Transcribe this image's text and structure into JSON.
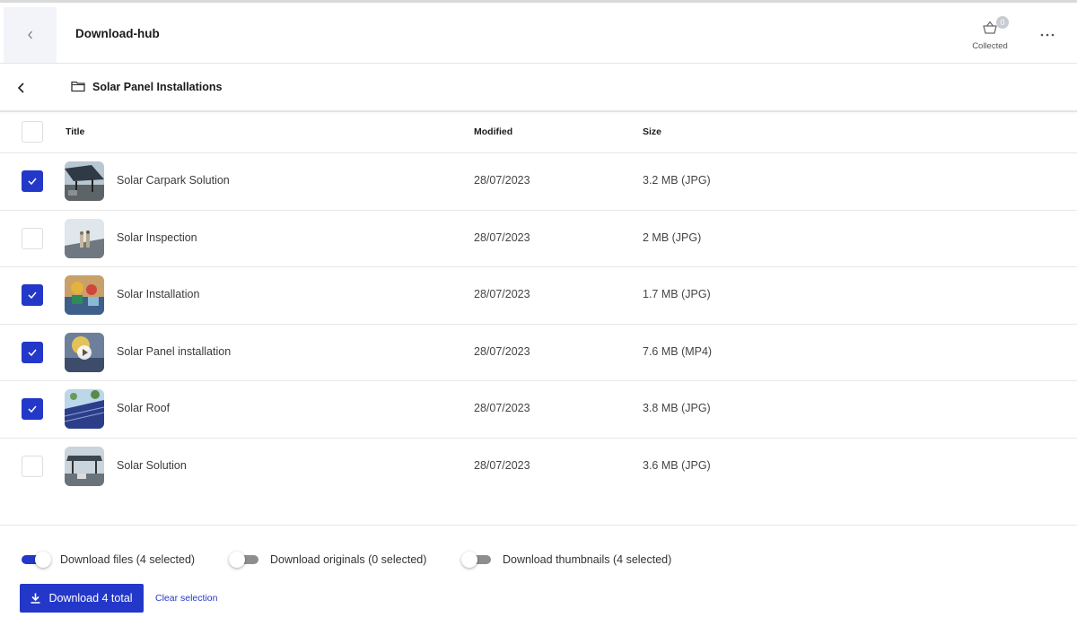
{
  "header": {
    "app_title": "Download-hub",
    "collected_label": "Collected",
    "collected_count": "0",
    "back_icon": "chevron-left-icon",
    "basket_icon": "basket-icon",
    "more_icon": "more-horizontal-icon"
  },
  "folder": {
    "name": "Solar Panel Installations",
    "icon": "folder-icon"
  },
  "table": {
    "columns": [
      "Title",
      "Modified",
      "Size"
    ],
    "rows": [
      {
        "title": "Solar Carpark Solution",
        "modified": "28/07/2023",
        "size": "3.2 MB (JPG)",
        "checked": true
      },
      {
        "title": "Solar Inspection",
        "modified": "28/07/2023",
        "size": "2 MB (JPG)",
        "checked": false
      },
      {
        "title": "Solar Installation",
        "modified": "28/07/2023",
        "size": "1.7 MB (JPG)",
        "checked": true
      },
      {
        "title": "Solar Panel installation",
        "modified": "28/07/2023",
        "size": "7.6 MB (MP4)",
        "checked": true
      },
      {
        "title": "Solar Roof",
        "modified": "28/07/2023",
        "size": "3.8 MB (JPG)",
        "checked": true
      },
      {
        "title": "Solar Solution",
        "modified": "28/07/2023",
        "size": "3.6 MB (JPG)",
        "checked": false
      }
    ]
  },
  "footer": {
    "toggles": [
      {
        "label": "Download files (4 selected)",
        "on": true
      },
      {
        "label": "Download originals (0 selected)",
        "on": false
      },
      {
        "label": "Download thumbnails (4 selected)",
        "on": false
      }
    ],
    "download_label": "Download 4 total",
    "clear_label": "Clear selection"
  },
  "colors": {
    "accent": "#2338c9",
    "toggle_off": "#8e8e8e",
    "back_box": "#f3f4f9"
  }
}
